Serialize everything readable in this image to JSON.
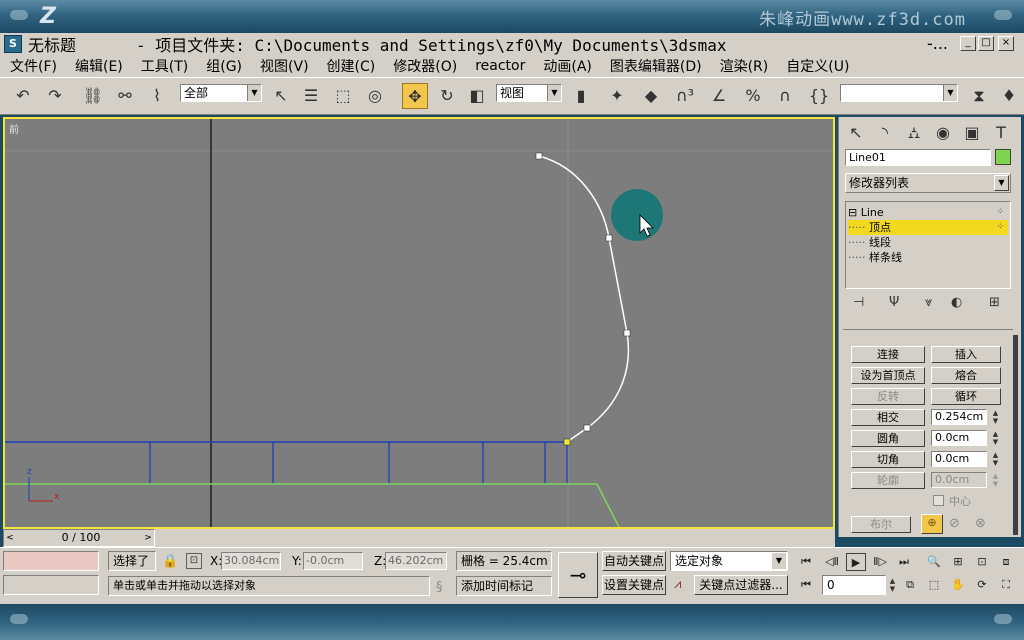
{
  "frame": {
    "brand": "朱峰动画www.zf3d.com",
    "logo": "Z"
  },
  "titlebar": {
    "app_icon": "S",
    "title": "无标题",
    "path": "- 项目文件夹: C:\\Documents and Settings\\zf0\\My Documents\\3dsmax",
    "ellipsis": "-...",
    "minimize": "_",
    "maximize": "□",
    "close": "×"
  },
  "menu": [
    "文件(F)",
    "编辑(E)",
    "工具(T)",
    "组(G)",
    "视图(V)",
    "创建(C)",
    "修改器(O)",
    "reactor",
    "动画(A)",
    "图表编辑器(D)",
    "渲染(R)",
    "自定义(U)"
  ],
  "toolbar": {
    "selection_filter": "全部",
    "ref_coord": "视图",
    "named_selection": "",
    "icons": {
      "undo": "↶",
      "redo": "↷",
      "link": "⛓",
      "unlink": "⚯",
      "bind": "⌇",
      "select": "↖",
      "select_by_name": "☰",
      "rect_region": "⬚",
      "window_crossing": "◎",
      "move": "✥",
      "rotate": "↻",
      "scale": "◧",
      "mirror": "⧗",
      "align": "⬓",
      "snap3": "∩³",
      "angle_snap": "∠",
      "percent_snap": "%",
      "spinner_snap": "∩",
      "abc": "{}",
      "curve": "♦"
    }
  },
  "viewport": {
    "label": "前"
  },
  "command_panel": {
    "tabs": [
      "↖",
      "◝",
      "⛼",
      "◉",
      "▣",
      "T"
    ],
    "object_name": "Line01",
    "object_color": "#7fd64e",
    "modifier_list": "修改器列表",
    "stack": [
      {
        "label": "Line",
        "prefix": "⊟"
      },
      {
        "label": "顶点",
        "prefix": "·····"
      },
      {
        "label": "线段",
        "prefix": "·····"
      },
      {
        "label": "样条线",
        "prefix": "·····"
      }
    ],
    "stack_tools": [
      "⊣",
      "Ψ",
      "⩔",
      "◐",
      "⊞"
    ],
    "buttons": {
      "connect": "连接",
      "insert": "插入",
      "make_first": "设为首顶点",
      "fuse": "熔合",
      "reverse": "反转",
      "cycle": "循环",
      "cross_insert": "相交",
      "fillet": "圆角",
      "chamfer": "切角",
      "outline": "轮廓",
      "boolean": "布尔"
    },
    "values": {
      "cross_insert": "0.254cm",
      "fillet": "0.0cm",
      "chamfer": "0.0cm",
      "outline": "0.0cm"
    },
    "center_label": "中心"
  },
  "timeslider": {
    "value": "0 / 100",
    "left": "<",
    "right": ">"
  },
  "status": {
    "selected": "选择了",
    "x_label": "X:",
    "x_value": "30.084cm",
    "y_label": "Y:",
    "y_value": "-0.0cm",
    "z_label": "Z:",
    "z_value": "46.202cm",
    "grid": "栅格 = 25.4cm",
    "prompt": "单击或单击并拖动以选择对象",
    "add_time_tag": "添加时间标记",
    "auto_key": "自动关键点",
    "set_key": "设置关键点",
    "key_mode": "选定对象",
    "key_filters": "关键点过滤器...",
    "frame": "0"
  }
}
